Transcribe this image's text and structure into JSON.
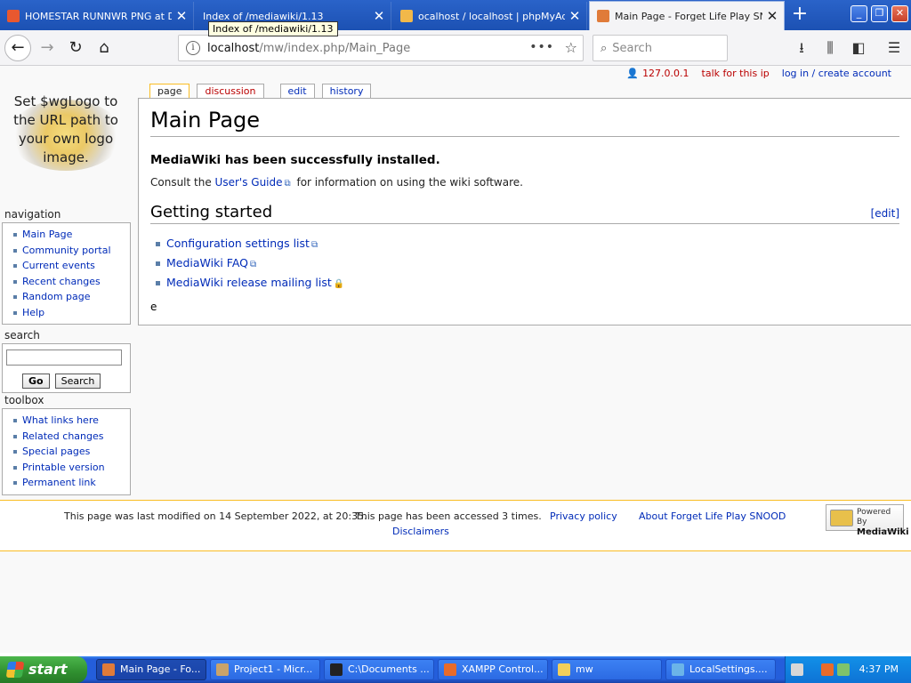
{
  "browser": {
    "tabs": [
      {
        "title": "HOMESTAR RUNNWR PNG at Du",
        "close": "✕"
      },
      {
        "title": "Index of /mediawiki/1.13",
        "close": "✕"
      },
      {
        "title": "ocalhost / localhost | phpMyAdm",
        "close": "✕"
      },
      {
        "title": "Main Page - Forget Life Play SNO",
        "close": "✕"
      }
    ],
    "new_tab": "+",
    "tooltip": "Index of /mediawiki/1.13",
    "url_host": "localhost",
    "url_path": "/mw/index.php/Main_Page",
    "search_placeholder": "Search",
    "window_controls": {
      "minimize": "_",
      "restore": "❐",
      "close": "✕"
    }
  },
  "wiki": {
    "personal": {
      "ip": "127.0.0.1",
      "talk": "talk for this ip",
      "login": "log in / create account"
    },
    "logo_text": "Set $wgLogo to the URL path to your own logo image.",
    "tabs": {
      "page": "page",
      "discussion": "discussion",
      "edit": "edit",
      "history": "history"
    },
    "navigation": {
      "heading": "navigation",
      "items": [
        "Main Page",
        "Community portal",
        "Current events",
        "Recent changes",
        "Random page",
        "Help"
      ]
    },
    "search": {
      "heading": "search",
      "go": "Go",
      "search": "Search"
    },
    "toolbox": {
      "heading": "toolbox",
      "items": [
        "What links here",
        "Related changes",
        "Special pages",
        "Printable version",
        "Permanent link"
      ]
    },
    "content": {
      "title": "Main Page",
      "installed": "MediaWiki has been successfully installed.",
      "consult_prefix": "Consult the ",
      "users_guide": "User's Guide",
      "consult_suffix": " for information on using the wiki software.",
      "getting_started": "Getting started",
      "edit": "[edit]",
      "links": [
        "Configuration settings list",
        "MediaWiki FAQ",
        "MediaWiki release mailing list"
      ],
      "stray": "e"
    },
    "footer": {
      "modified": "This page was last modified on 14 September 2022, at 20:35.",
      "accessed": "This page has been accessed 3 times.",
      "privacy": "Privacy policy",
      "about": "About Forget Life Play SNOOD",
      "disclaimers": "Disclaimers",
      "powered_by": "Powered By",
      "mediawiki": "MediaWiki"
    }
  },
  "taskbar": {
    "start": "start",
    "tasks": [
      "Main Page - Fo...",
      "Project1 - Micr...",
      "C:\\Documents ...",
      "XAMPP Control...",
      "mw",
      "LocalSettings...."
    ],
    "clock": "4:37 PM"
  }
}
